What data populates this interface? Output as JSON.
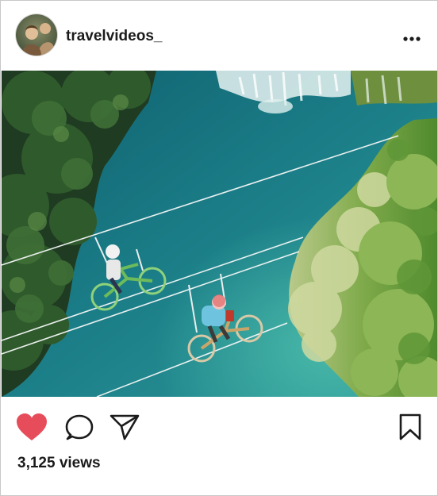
{
  "post": {
    "username": "travelvideos_",
    "views_label": "3,125 views"
  },
  "icons": {
    "avatar": "profile-photo",
    "more": "more-horizontal-icon",
    "like": "heart-icon",
    "comment": "comment-bubble-icon",
    "share": "paper-plane-icon",
    "save": "bookmark-icon"
  },
  "colors": {
    "like_active": "#e74c5a",
    "text": "#1b1b1b",
    "border": "#c8c8c8"
  },
  "state": {
    "liked": true
  }
}
